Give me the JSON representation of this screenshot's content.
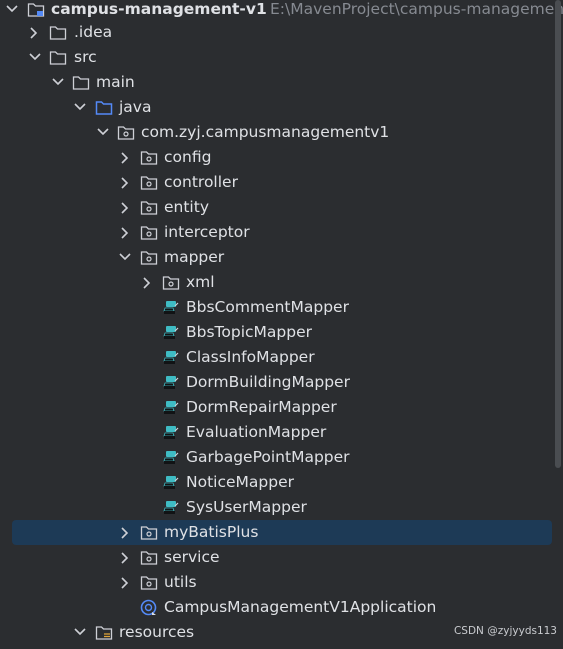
{
  "project": {
    "name": "campus-management-v1",
    "path": "E:\\MavenProject\\campus-managemen"
  },
  "tree": {
    "idea": ".idea",
    "src": "src",
    "main": "main",
    "java": "java",
    "package": "com.zyj.campusmanagementv1",
    "config": "config",
    "controller": "controller",
    "entity": "entity",
    "interceptor": "interceptor",
    "mapper": "mapper",
    "xml": "xml",
    "mappers": [
      "BbsCommentMapper",
      "BbsTopicMapper",
      "ClassInfoMapper",
      "DormBuildingMapper",
      "DormRepairMapper",
      "EvaluationMapper",
      "GarbagePointMapper",
      "NoticeMapper",
      "SysUserMapper"
    ],
    "myBatisPlus": "myBatisPlus",
    "service": "service",
    "utils": "utils",
    "application": "CampusManagementV1Application",
    "resources": "resources"
  },
  "watermark": "CSDN @zyjyyds113",
  "colors": {
    "background": "#2b2d30",
    "selection": "#1d3a56",
    "text": "#dfe1e5",
    "path_text": "#868a91",
    "folder_icon": "#ced0d6",
    "source_folder": "#548af7",
    "mapper_icon": "#3fbcc4"
  }
}
